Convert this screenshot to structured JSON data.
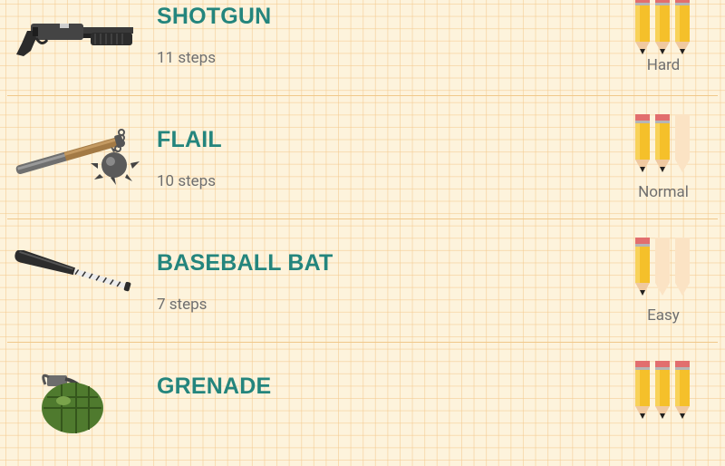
{
  "weapons": [
    {
      "name": "SHOTGUN",
      "steps": "11 steps",
      "difficulty": "Hard",
      "difficulty_level": 3,
      "icon": "shotgun-icon"
    },
    {
      "name": "FLAIL",
      "steps": "10 steps",
      "difficulty": "Normal",
      "difficulty_level": 2,
      "icon": "flail-icon"
    },
    {
      "name": "BASEBALL BAT",
      "steps": "7 steps",
      "difficulty": "Easy",
      "difficulty_level": 1,
      "icon": "baseball-bat-icon"
    },
    {
      "name": "GRENADE",
      "steps": "",
      "difficulty": "",
      "difficulty_level": 3,
      "icon": "grenade-icon"
    }
  ],
  "difficulty_max": 3,
  "colors": {
    "title": "#24857d",
    "text": "#6f6f6f",
    "background": "#fdf3dc",
    "grid": "#f4c88c",
    "divider": "#f0c88a",
    "pencil_active": "#f5c02a",
    "pencil_inactive": "#fbe3c4"
  }
}
